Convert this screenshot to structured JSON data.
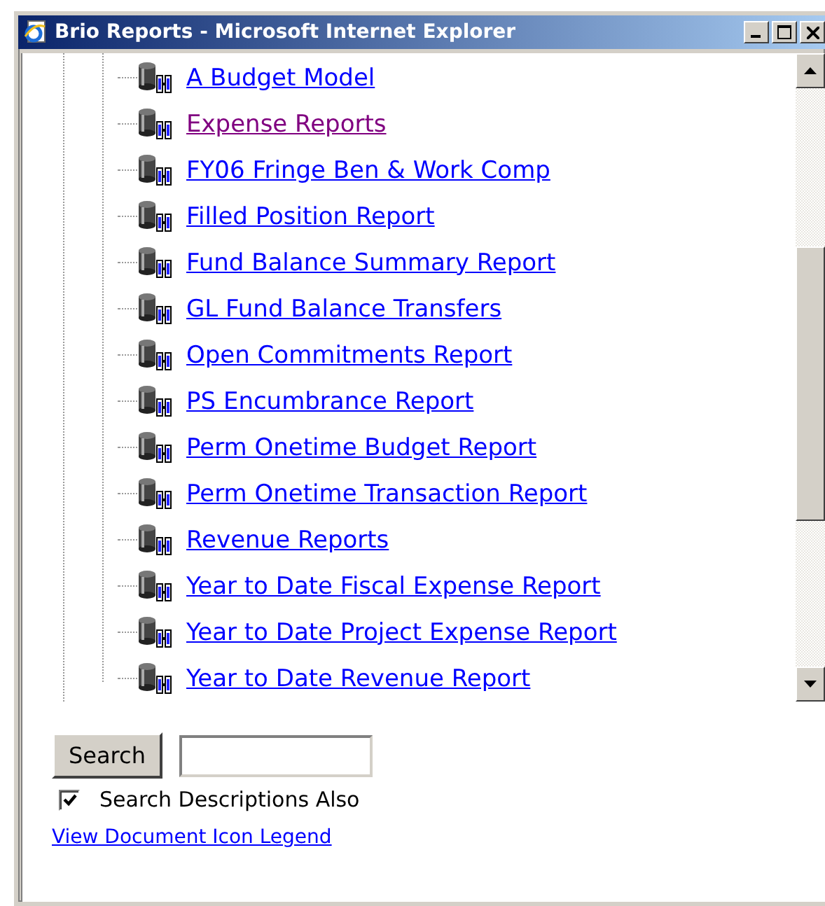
{
  "window": {
    "title": "Brio Reports - Microsoft Internet Explorer"
  },
  "reports": [
    {
      "label": "A Budget Model",
      "visited": false
    },
    {
      "label": "Expense Reports",
      "visited": true
    },
    {
      "label": "FY06 Fringe Ben & Work Comp",
      "visited": false
    },
    {
      "label": "Filled Position Report",
      "visited": false
    },
    {
      "label": "Fund Balance Summary Report",
      "visited": false
    },
    {
      "label": "GL Fund Balance Transfers",
      "visited": false
    },
    {
      "label": "Open Commitments Report",
      "visited": false
    },
    {
      "label": "PS Encumbrance Report",
      "visited": false
    },
    {
      "label": "Perm Onetime Budget Report",
      "visited": false
    },
    {
      "label": "Perm Onetime Transaction Report",
      "visited": false
    },
    {
      "label": "Revenue Reports",
      "visited": false
    },
    {
      "label": "Year to Date Fiscal Expense Report",
      "visited": false
    },
    {
      "label": "Year to Date Project Expense Report",
      "visited": false
    },
    {
      "label": "Year to Date Revenue Report",
      "visited": false
    }
  ],
  "search": {
    "button": "Search",
    "checkbox_label": "Search Descriptions Also",
    "checked": true
  },
  "legend_link": "View Document Icon Legend"
}
